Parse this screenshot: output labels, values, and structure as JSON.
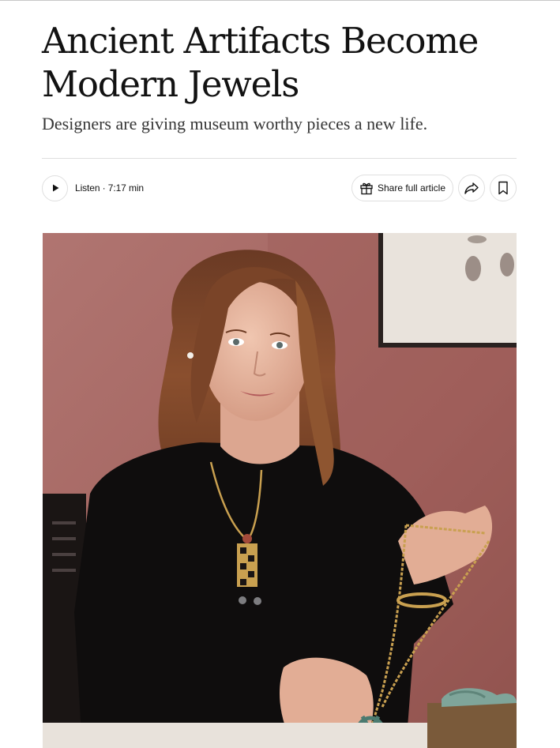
{
  "article": {
    "headline": "Ancient Artifacts Become Modern Jewels",
    "dek": "Designers are giving museum worthy pieces a new life."
  },
  "toolbar": {
    "listen_label": "Listen · 7:17 min",
    "share_full_label": "Share full article",
    "icons": {
      "play": "play-icon",
      "gift": "gift-icon",
      "share": "share-icon",
      "bookmark": "bookmark-icon"
    }
  },
  "photo": {
    "subject": "lead-photo"
  },
  "colors": {
    "text": "#121212",
    "dek": "#363636",
    "border": "#dfdfdf",
    "wall": "#a86a67"
  }
}
